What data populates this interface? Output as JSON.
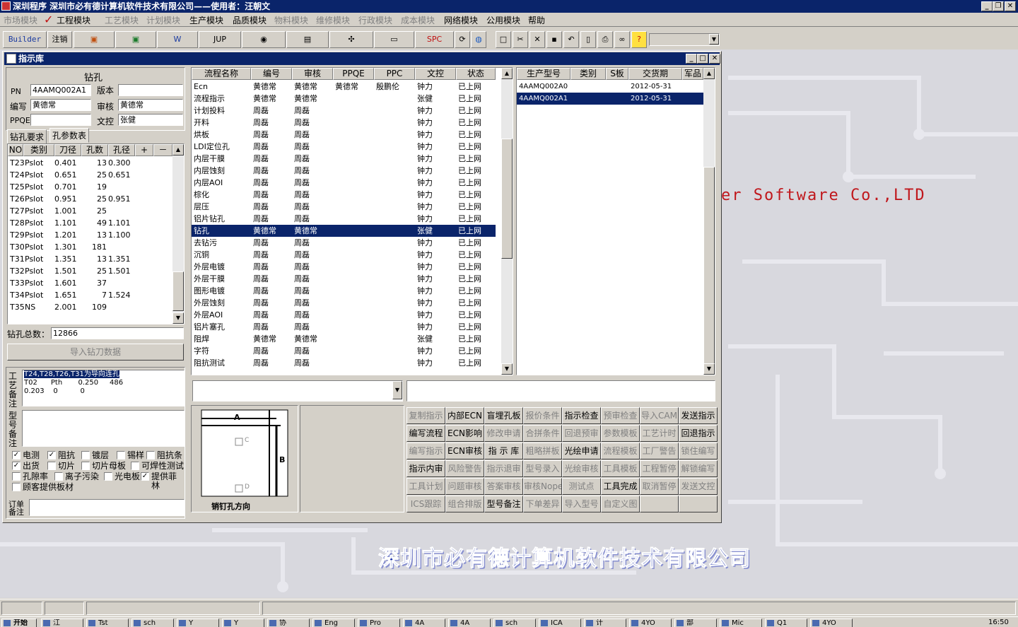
{
  "app": {
    "title": "深圳程序    深圳市必有德计算机软件技术有限公司——使用者：汪朝文"
  },
  "menu": [
    "市场模块",
    "工程模块",
    "工艺模块",
    "计划模块",
    "生产模块",
    "品质模块",
    "物料模块",
    "维修模块",
    "行政模块",
    "成本模块",
    "网络模块",
    "公用模块",
    "帮助"
  ],
  "menu_enabled": [
    false,
    true,
    false,
    false,
    true,
    true,
    false,
    false,
    false,
    false,
    true,
    true,
    true
  ],
  "toolbar": {
    "builder": "Builder",
    "logout": "注销",
    "jup": "JUP",
    "spc": "SPC"
  },
  "window": {
    "title": "指示库"
  },
  "left": {
    "section_title": "钻孔",
    "pn_label": "PN",
    "pn_value": "4AAMQ002A1",
    "version_label": "版本",
    "version_value": "",
    "author_label": "编写",
    "author_value": "黄德常",
    "review_label": "审核",
    "review_value": "黄德常",
    "ppqe_label": "PPQE",
    "ppqe_value": "",
    "doc_label": "文控",
    "doc_value": "张健",
    "tab1": "钻孔要求",
    "tab2": "孔参数表",
    "grid_headers": [
      "NO",
      "类别",
      "刀径",
      "孔数",
      "孔径",
      "+",
      "－"
    ],
    "grid_rows": [
      [
        "T23",
        "Pslot",
        "0.401",
        "13",
        "0.300"
      ],
      [
        "T24",
        "Pslot",
        "0.651",
        "25",
        "0.651"
      ],
      [
        "T25",
        "Pslot",
        "0.701",
        "19",
        ""
      ],
      [
        "T26",
        "Pslot",
        "0.951",
        "25",
        "0.951"
      ],
      [
        "T27",
        "Pslot",
        "1.001",
        "25",
        ""
      ],
      [
        "T28",
        "Pslot",
        "1.101",
        "49",
        "1.101"
      ],
      [
        "T29",
        "Pslot",
        "1.201",
        "13",
        "1.100"
      ],
      [
        "T30",
        "Pslot",
        "1.301",
        "181",
        ""
      ],
      [
        "T31",
        "Pslot",
        "1.351",
        "13",
        "1.351"
      ],
      [
        "T32",
        "Pslot",
        "1.501",
        "25",
        "1.501"
      ],
      [
        "T33",
        "Pslot",
        "1.601",
        "37",
        ""
      ],
      [
        "T34",
        "Pslot",
        "1.651",
        "7",
        "1.524"
      ],
      [
        "T35",
        "NS",
        "2.001",
        "109",
        ""
      ]
    ],
    "total_label": "钻孔总数：",
    "total_value": "12866",
    "import_button": "导入钻刀数据",
    "process_note_label": "工艺备注",
    "process_note_line1": "T24,T28,T26,T31为导向连孔",
    "process_note_line2": "T02      Pth       0.250     486",
    "process_note_line3": "0.203    0          0",
    "model_note_label": "型号备注",
    "checks": [
      {
        "label": "电测",
        "checked": true
      },
      {
        "label": "阻抗",
        "checked": true
      },
      {
        "label": "镀层",
        "checked": false
      },
      {
        "label": "锡样",
        "checked": false
      },
      {
        "label": "阻抗条",
        "checked": false
      },
      {
        "label": "出货",
        "checked": true
      },
      {
        "label": "切片",
        "checked": false
      },
      {
        "label": "切片母板",
        "checked": false
      },
      {
        "label": "可焊性测试",
        "checked": false
      },
      {
        "label": "孔隙率",
        "checked": false
      },
      {
        "label": "离子污染",
        "checked": false
      },
      {
        "label": "光电板",
        "checked": false
      },
      {
        "label": "提供菲林",
        "checked": true
      },
      {
        "label": "顾客提供板材",
        "checked": false
      }
    ],
    "order_note_label": "订单备注"
  },
  "flow": {
    "headers": [
      "流程名称",
      "编号",
      "审核",
      "PPQE",
      "PPC",
      "文控",
      "状态"
    ],
    "rows": [
      [
        "Ecn",
        "黄德常",
        "黄德常",
        "黄德常",
        "殷鹏伦",
        "钟力",
        "已上网"
      ],
      [
        "流程指示",
        "黄德常",
        "黄德常",
        "",
        "",
        "张健",
        "已上网"
      ],
      [
        "计划投料",
        "周磊",
        "周磊",
        "",
        "",
        "钟力",
        "已上网"
      ],
      [
        "开料",
        "周磊",
        "周磊",
        "",
        "",
        "钟力",
        "已上网"
      ],
      [
        "烘板",
        "周磊",
        "周磊",
        "",
        "",
        "钟力",
        "已上网"
      ],
      [
        "LDI定位孔",
        "周磊",
        "周磊",
        "",
        "",
        "钟力",
        "已上网"
      ],
      [
        "内层干膜",
        "周磊",
        "周磊",
        "",
        "",
        "钟力",
        "已上网"
      ],
      [
        "内层蚀刻",
        "周磊",
        "周磊",
        "",
        "",
        "钟力",
        "已上网"
      ],
      [
        "内层AOI",
        "周磊",
        "周磊",
        "",
        "",
        "钟力",
        "已上网"
      ],
      [
        "棕化",
        "周磊",
        "周磊",
        "",
        "",
        "钟力",
        "已上网"
      ],
      [
        "层压",
        "周磊",
        "周磊",
        "",
        "",
        "钟力",
        "已上网"
      ],
      [
        "铝片钻孔",
        "周磊",
        "周磊",
        "",
        "",
        "钟力",
        "已上网"
      ],
      [
        "钻孔",
        "黄德常",
        "黄德常",
        "",
        "",
        "张健",
        "已上网"
      ],
      [
        "去钻污",
        "周磊",
        "周磊",
        "",
        "",
        "钟力",
        "已上网"
      ],
      [
        "沉铜",
        "周磊",
        "周磊",
        "",
        "",
        "钟力",
        "已上网"
      ],
      [
        "外层电镀",
        "周磊",
        "周磊",
        "",
        "",
        "钟力",
        "已上网"
      ],
      [
        "外层干膜",
        "周磊",
        "周磊",
        "",
        "",
        "钟力",
        "已上网"
      ],
      [
        "图形电镀",
        "周磊",
        "周磊",
        "",
        "",
        "钟力",
        "已上网"
      ],
      [
        "外层蚀刻",
        "周磊",
        "周磊",
        "",
        "",
        "钟力",
        "已上网"
      ],
      [
        "外层AOI",
        "周磊",
        "周磊",
        "",
        "",
        "钟力",
        "已上网"
      ],
      [
        "铝片塞孔",
        "周磊",
        "周磊",
        "",
        "",
        "钟力",
        "已上网"
      ],
      [
        "阻焊",
        "黄德常",
        "黄德常",
        "",
        "",
        "张健",
        "已上网"
      ],
      [
        "字符",
        "周磊",
        "周磊",
        "",
        "",
        "钟力",
        "已上网"
      ],
      [
        "阻抗测试",
        "周磊",
        "周磊",
        "",
        "",
        "钟力",
        "已上网"
      ]
    ],
    "selected_index": 12
  },
  "models": {
    "headers": [
      "生产型号",
      "类别",
      "S板",
      "交货期",
      "军品"
    ],
    "rows": [
      [
        "4AAMQ002A0",
        "",
        "",
        "2012-05-31",
        ""
      ],
      [
        "4AAMQ002A1",
        "",
        "",
        "2012-05-31",
        ""
      ]
    ],
    "selected_index": 1
  },
  "pin": {
    "a": "A",
    "b": "B",
    "c": "C",
    "d": "D",
    "caption": "销钉孔方向"
  },
  "actions": [
    [
      "复制指示",
      "内部ECN",
      "盲埋孔板",
      "报价条件",
      "指示检查",
      "预审检查",
      "导入CAM",
      "发送指示"
    ],
    [
      "编写流程",
      "ECN影响",
      "修改申请",
      "合拼条件",
      "回退预审",
      "参数模板",
      "工艺计时",
      "回退指示"
    ],
    [
      "编写指示",
      "ECN审核",
      "指 示 库",
      "粗略拼板",
      "光绘申请",
      "流程模板",
      "工厂警告",
      "锁住编写"
    ],
    [
      "指示内审",
      "风险警告",
      "指示退审",
      "型号录入",
      "光绘审核",
      "工具模板",
      "工程暂停",
      "解锁编写"
    ],
    [
      "工具计划",
      "问题审核",
      "答案审核",
      "审核Nope",
      "测试点",
      "工具完成",
      "取消暂停",
      "发送文控"
    ],
    [
      "ICS跟踪",
      "组合排版",
      "型号备注",
      "下单差异",
      "导入型号",
      "自定义图",
      "",
      ""
    ]
  ],
  "actions_enabled": [
    [
      false,
      true,
      true,
      false,
      true,
      false,
      false,
      true
    ],
    [
      true,
      true,
      false,
      false,
      false,
      false,
      false,
      true
    ],
    [
      false,
      true,
      true,
      false,
      true,
      false,
      false,
      false
    ],
    [
      true,
      false,
      false,
      false,
      false,
      false,
      false,
      false
    ],
    [
      false,
      false,
      false,
      false,
      false,
      true,
      false,
      false
    ],
    [
      false,
      false,
      true,
      false,
      false,
      false,
      false,
      false
    ]
  ],
  "brand": {
    "en": "er Software Co.,LTD",
    "cn": "深圳市必有德计算机软件技术有限公司"
  },
  "taskbar": {
    "start": "开始",
    "items": [
      "江",
      "Tst",
      "sch",
      "Y",
      "Y",
      "协",
      "Eng",
      "Pro",
      "4A",
      "4A",
      "sch",
      "ICA",
      "计",
      "4YO",
      "部",
      "Mic",
      "Q1",
      "4YO"
    ],
    "clock": "16:50"
  }
}
